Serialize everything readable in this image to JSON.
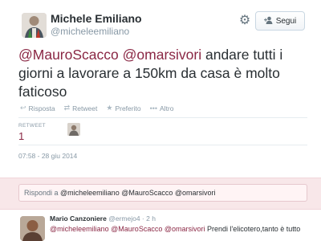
{
  "profile": {
    "name": "Michele Emiliano",
    "handle": "@micheleemiliano"
  },
  "header": {
    "settings_icon": "gear-icon",
    "follow_label": "Segui",
    "follow_icon": "add-user-icon"
  },
  "tweet": {
    "mention_1": "@MauroScacco",
    "mention_2": "@omarsivori",
    "text_rest": " andare tutti i giorni a lavorare a 150km da casa è molto faticoso"
  },
  "actions": {
    "reply": "Risposta",
    "retweet": "Retweet",
    "favorite": "Preferito",
    "more": "Altro"
  },
  "stats": {
    "retweet_label": "RETWEET",
    "retweet_count": "1"
  },
  "timestamp": "07:58 - 28 giu 2014",
  "reply_box": {
    "prefix": "Rispondi a ",
    "mentions": "@micheleemiliano @MauroScacco @omarsivori"
  },
  "reply": {
    "name": "Mario Canzoniere",
    "meta": " @ermejo4 · 2 h",
    "mentions": "@micheleemiliano @MauroScacco @omarsivori",
    "text": " Prendi l'elicotero,tanto è tutto"
  },
  "colors": {
    "accent": "#8a2744",
    "reply_bg": "#f8e7e9",
    "muted": "#8899a6"
  }
}
